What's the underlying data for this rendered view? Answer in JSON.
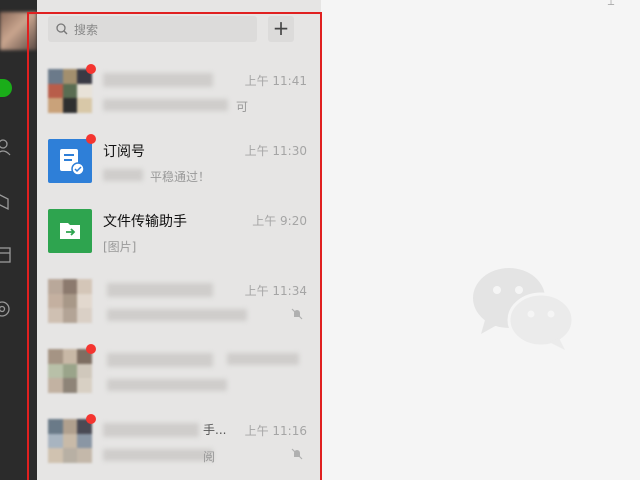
{
  "search": {
    "placeholder": "搜索"
  },
  "add_button": {
    "label": "+"
  },
  "chats": [
    {
      "name": "",
      "time": "上午 11:41",
      "preview": "可",
      "unread": true,
      "muted": false,
      "avatar": "group-mosaic"
    },
    {
      "name": "订阅号",
      "time": "上午 11:30",
      "preview": "平稳通过！",
      "unread": true,
      "muted": false,
      "avatar": "subscription-icon"
    },
    {
      "name": "文件传输助手",
      "time": "上午 9:20",
      "preview": "[图片]",
      "unread": false,
      "muted": false,
      "avatar": "file-transfer-icon"
    },
    {
      "name": "",
      "time": "上午 11:34",
      "preview": "",
      "unread": false,
      "muted": true,
      "avatar": "group-mosaic"
    },
    {
      "name": "",
      "time": "",
      "preview": "",
      "unread": true,
      "muted": false,
      "avatar": "group-mosaic"
    },
    {
      "name": "手...",
      "time": "上午 11:16",
      "preview": "阅",
      "unread": true,
      "muted": true,
      "avatar": "group-mosaic"
    }
  ],
  "colors": {
    "accent": "#1aad19",
    "badge": "#f43530",
    "highlight": "#e02020"
  }
}
